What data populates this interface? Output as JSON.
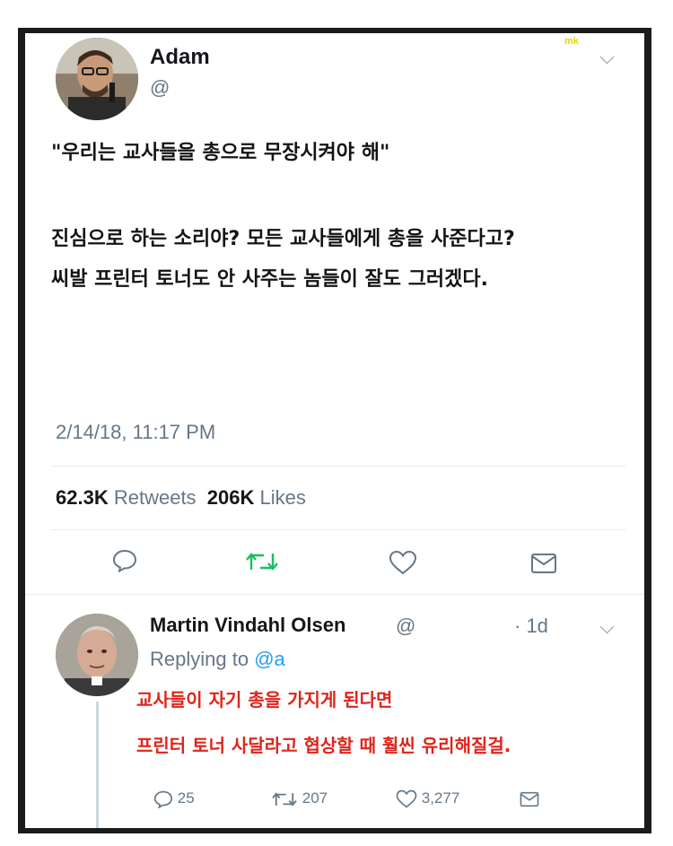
{
  "watermark": "mk",
  "tweet": {
    "author_name": "Adam",
    "author_handle": "@",
    "lines": [
      "\"우리는 교사들을 총으로 무장시켜야 해\"",
      "진심으로 하는 소리야? 모든 교사들에게 총을 사준다고?",
      "씨발 프린터 토너도 안 사주는 놈들이 잘도 그러겠다."
    ],
    "timestamp": "2/14/18, 11:17 PM",
    "retweets_count": "62.3K",
    "retweets_label": "Retweets",
    "likes_count": "206K",
    "likes_label": "Likes",
    "icons": [
      "reply-icon",
      "retweet-icon",
      "like-icon",
      "dm-icon"
    ],
    "retweet_color": "#17bf63"
  },
  "reply": {
    "author_name": "Martin Vindahl Olsen",
    "author_handle": "@",
    "time": "· 1d",
    "replying_label": "Replying to",
    "replying_handle": "@a",
    "lines": [
      "교사들이 자기 총을 가지게 된다면",
      "프린터 토너 사달라고 협상할 때 훨씬 유리해질걸."
    ],
    "reply_count": "25",
    "retweet_count": "207",
    "like_count": "3,277",
    "overlay_color": "#e0241b"
  }
}
